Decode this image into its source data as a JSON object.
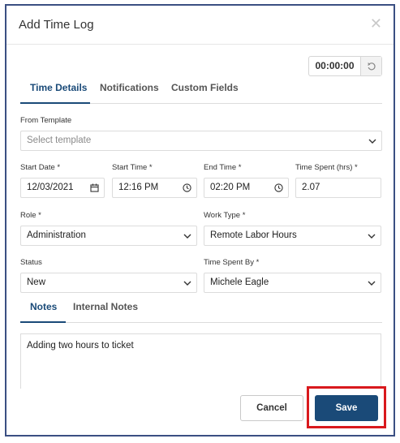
{
  "dialog": {
    "title": "Add Time Log",
    "close_icon": "close-icon"
  },
  "timer": {
    "value": "00:00:00",
    "reset_icon": "reset-icon"
  },
  "top_tabs": [
    {
      "label": "Time Details",
      "active": true
    },
    {
      "label": "Notifications",
      "active": false
    },
    {
      "label": "Custom Fields",
      "active": false
    }
  ],
  "form": {
    "template": {
      "label": "From Template",
      "placeholder": "Select template"
    },
    "start_date": {
      "label": "Start Date *",
      "value": "12/03/2021"
    },
    "start_time": {
      "label": "Start Time *",
      "value": "12:16 PM"
    },
    "end_time": {
      "label": "End Time *",
      "value": "02:20 PM"
    },
    "time_spent": {
      "label": "Time Spent (hrs) *",
      "value": "2.07"
    },
    "role": {
      "label": "Role *",
      "value": "Administration"
    },
    "work_type": {
      "label": "Work Type *",
      "value": "Remote Labor Hours"
    },
    "status": {
      "label": "Status",
      "value": "New"
    },
    "time_spent_by": {
      "label": "Time Spent By *",
      "value": "Michele Eagle"
    }
  },
  "note_tabs": [
    {
      "label": "Notes",
      "active": true
    },
    {
      "label": "Internal Notes",
      "active": false
    }
  ],
  "notes": {
    "text": "Adding two hours to ticket"
  },
  "buttons": {
    "cancel": "Cancel",
    "save": "Save"
  },
  "colors": {
    "accent": "#1a4a78",
    "highlight": "#d9191d",
    "frame": "#3b4f82"
  }
}
